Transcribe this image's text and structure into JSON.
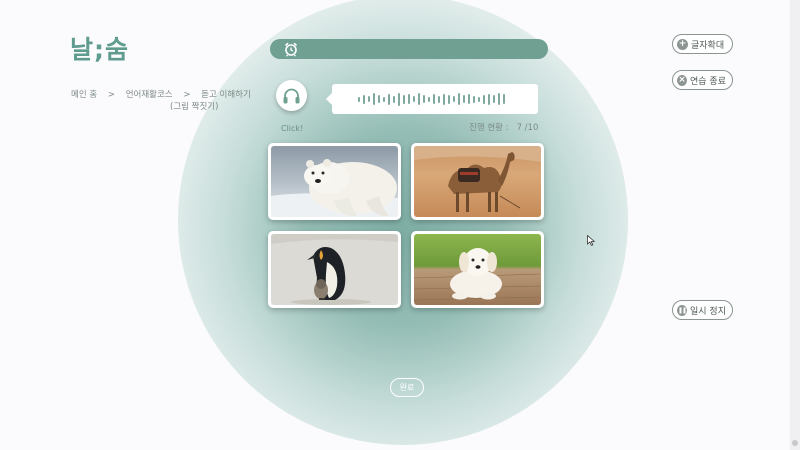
{
  "app": {
    "logo": "날;숨"
  },
  "breadcrumb": {
    "home": "메인 홈",
    "sep": ">",
    "course": "언어재활코스",
    "exercise": "듣고 이해하기",
    "exercise_sub": "(그림 짝짓기)"
  },
  "timer": {
    "icon": "alarm-clock-icon"
  },
  "audio": {
    "click_label": "Click!",
    "icon": "headphones-icon"
  },
  "progress": {
    "label": "진행 현황 :",
    "current": 7,
    "total": 10,
    "value": "7 /10"
  },
  "choices": [
    {
      "name": "polar-bear",
      "icon": "polar-bear-image"
    },
    {
      "name": "camel",
      "icon": "camel-image"
    },
    {
      "name": "penguin",
      "icon": "penguin-image"
    },
    {
      "name": "puppy",
      "icon": "puppy-image"
    }
  ],
  "submit": {
    "label": "완료"
  },
  "controls": {
    "zoom_label": "글자확대",
    "end_label": "연습 종료",
    "pause_label": "일시 정지"
  },
  "colors": {
    "accent": "#6fa092",
    "logo": "#5f9b8e",
    "text": "#7d8a87"
  }
}
